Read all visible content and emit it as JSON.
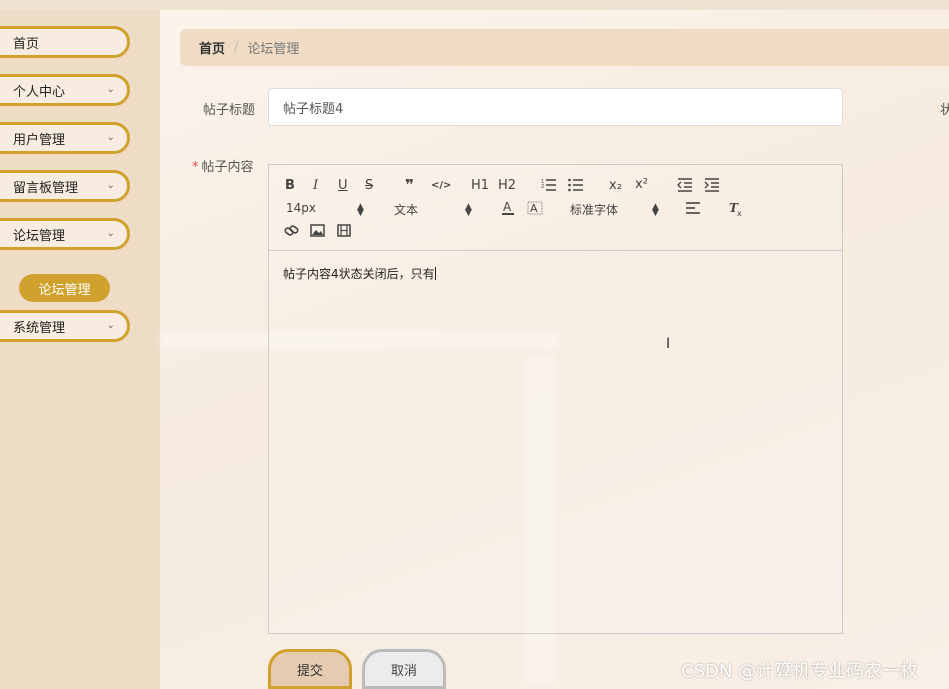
{
  "sidebar": {
    "items": [
      {
        "label": "首页",
        "has_chevron": false
      },
      {
        "label": "个人中心",
        "has_chevron": true
      },
      {
        "label": "用户管理",
        "has_chevron": true
      },
      {
        "label": "留言板管理",
        "has_chevron": true
      },
      {
        "label": "论坛管理",
        "has_chevron": true
      },
      {
        "label": "系统管理",
        "has_chevron": true
      }
    ],
    "active_subitem": "论坛管理"
  },
  "breadcrumb": {
    "home": "首页",
    "separator": "/",
    "current": "论坛管理"
  },
  "form": {
    "title_label": "帖子标题",
    "title_value": "帖子标题4",
    "content_label": "帖子内容",
    "required_mark": "*",
    "right_cut_label": "状"
  },
  "editor": {
    "toolbar": {
      "bold": "B",
      "italic": "I",
      "underline": "U",
      "strike": "S",
      "blockquote": "❞",
      "code": "</>",
      "h1": "H1",
      "h2": "H2",
      "subscript": "x₂",
      "superscript": "x²",
      "size_select": "14px",
      "header_select": "文本",
      "font_select": "标准字体"
    },
    "content_text": "帖子内容4状态关闭后，只有"
  },
  "buttons": {
    "submit": "提交",
    "cancel": "取消"
  },
  "watermark": "CSDN @计算机专业码农一枚",
  "colors": {
    "accent": "#cfa22d",
    "sidebar_bg": "#efdcc6",
    "breadcrumb_bg": "#f0dcc4"
  }
}
